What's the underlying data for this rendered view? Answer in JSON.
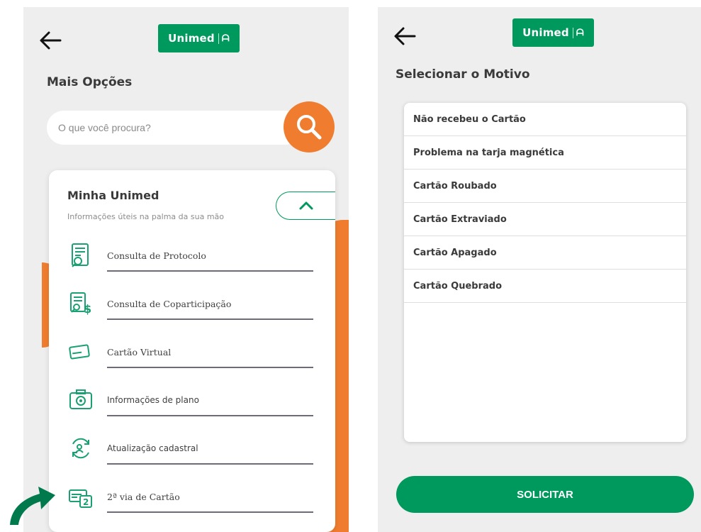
{
  "brand": {
    "name": "Unimed",
    "accent": "#00995d",
    "orange": "#f07d2f"
  },
  "left_screen": {
    "heading": "Mais Opções",
    "search": {
      "placeholder": "O que você procura?",
      "value": ""
    },
    "card": {
      "title": "Minha Unimed",
      "subtitle": "Informações úteis na palma da sua mão",
      "items": [
        {
          "label": "Consulta de Protocolo",
          "icon": "protocol-search-icon"
        },
        {
          "label": "Consulta de Coparticipação",
          "icon": "coparticipation-icon"
        },
        {
          "label": "Cartão Virtual",
          "icon": "virtual-card-icon"
        },
        {
          "label": "Informações de plano",
          "icon": "plan-info-icon"
        },
        {
          "label": "Atualização cadastral",
          "icon": "registration-update-icon"
        },
        {
          "label": "2ª via de Cartão",
          "icon": "card-copy-icon"
        }
      ]
    }
  },
  "right_screen": {
    "heading": "Selecionar o Motivo",
    "reasons": [
      "Não recebeu o Cartão",
      "Problema na tarja magnética",
      "Cartão Roubado",
      "Cartão Extraviado",
      "Cartão Apagado",
      "Cartão Quebrado"
    ],
    "submit_label": "SOLICITAR"
  }
}
